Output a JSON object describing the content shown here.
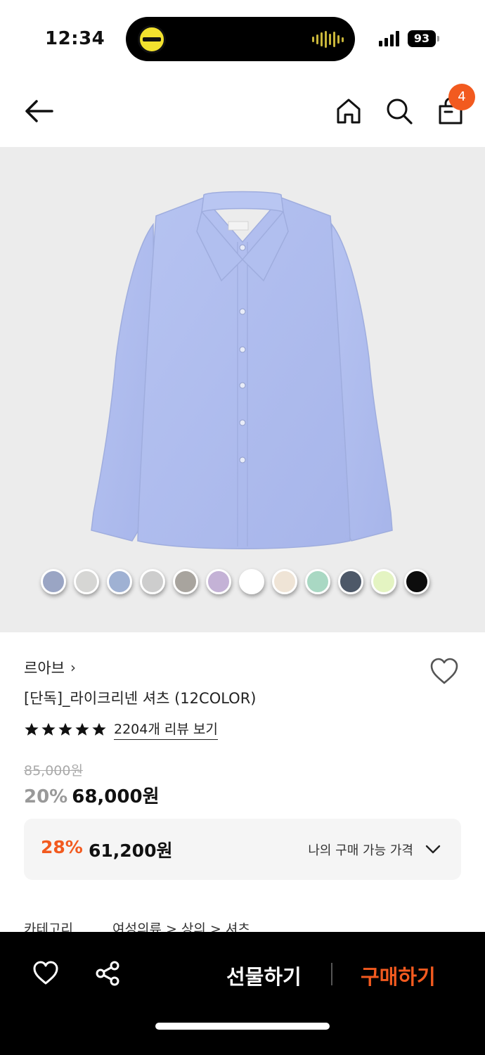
{
  "status_bar": {
    "time": "12:34",
    "battery": "93"
  },
  "header": {
    "cart_count": "4"
  },
  "swatch_colors": [
    "#9aa5c4",
    "#d6d6d4",
    "#9fb1d3",
    "#cdcdcd",
    "#a8a49e",
    "#c4b2d6",
    "#ffffff",
    "#efe4d6",
    "#a9d8c3",
    "#4d5868",
    "#e4f4c2",
    "#0d0d0d"
  ],
  "product": {
    "brand": "르아브",
    "name": "[단독]_라이크리넨 셔츠 (12COLOR)",
    "rating": 5,
    "review_text": "2204개 리뷰 보기",
    "original_price": "85,000원",
    "discount": "20%",
    "price": "68,000원"
  },
  "my_price": {
    "discount": "28%",
    "price": "61,200원",
    "label": "나의 구매 가능 가격"
  },
  "category": {
    "label": "카테고리",
    "path": "여성의류 > 상의 > 셔츠"
  },
  "bottom_bar": {
    "gift_label": "선물하기",
    "buy_label": "구매하기"
  },
  "colors": {
    "accent": "#f25a1f"
  }
}
